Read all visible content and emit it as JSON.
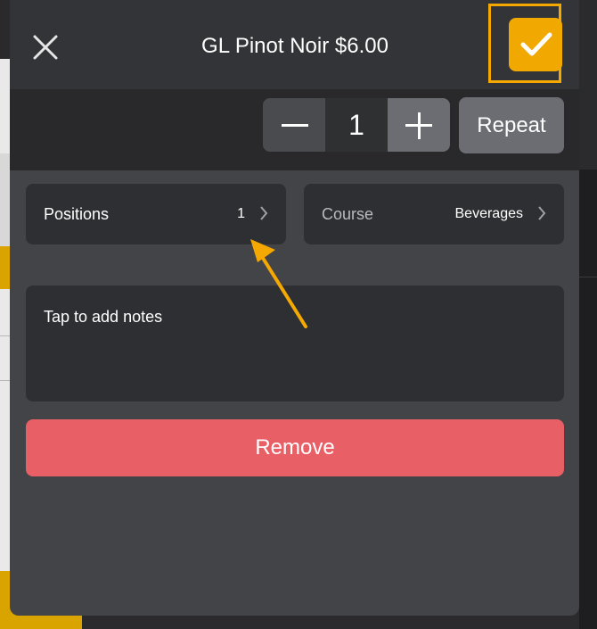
{
  "header": {
    "title": "GL Pinot Noir $6.00",
    "close_icon": "close-icon",
    "confirm_icon": "checkmark-icon",
    "accent_color": "#f1a800"
  },
  "quantity": {
    "value": "1",
    "minus_icon": "minus-icon",
    "plus_icon": "plus-icon",
    "repeat_label": "Repeat"
  },
  "fields": {
    "positions": {
      "label": "Positions",
      "value": "1"
    },
    "course": {
      "label": "Course",
      "value": "Beverages"
    }
  },
  "notes": {
    "placeholder": "Tap to add notes"
  },
  "actions": {
    "remove_label": "Remove",
    "remove_color": "#e85f66"
  },
  "annotation": {
    "arrow_icon": "annotation-arrow",
    "highlight_color": "#f5a800"
  }
}
